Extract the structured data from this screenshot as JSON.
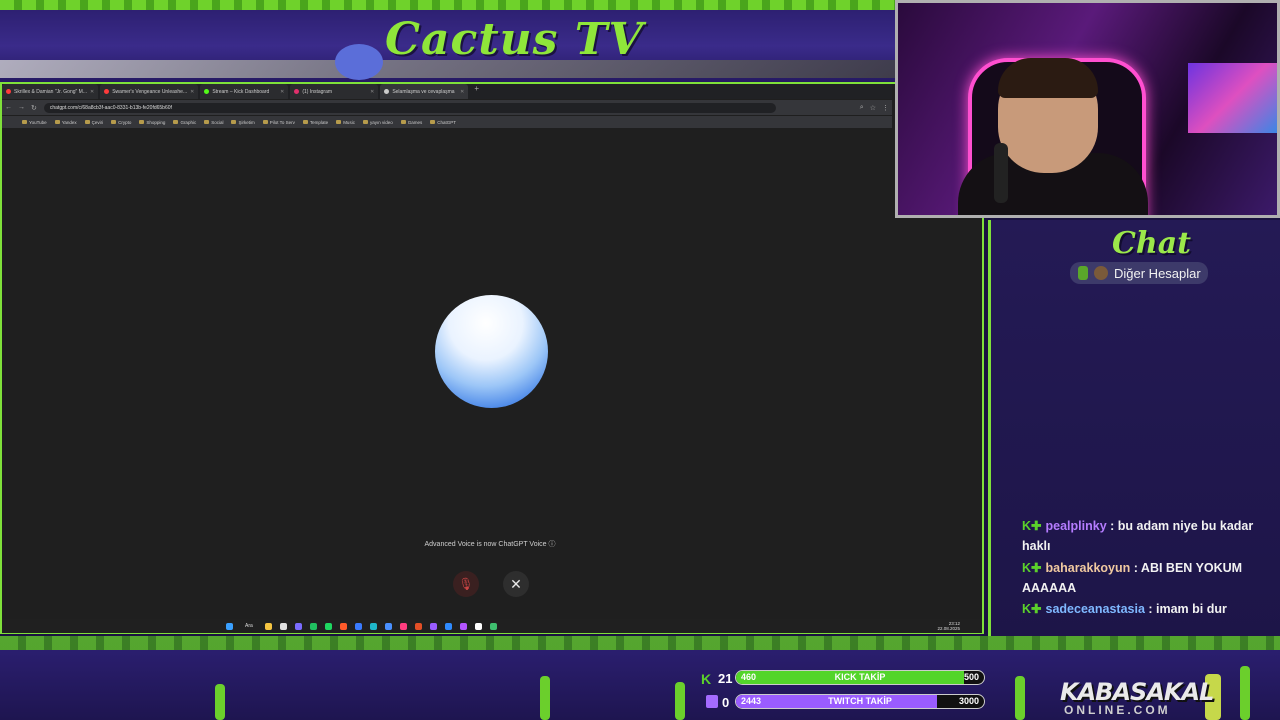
{
  "overlay": {
    "logo_text": "Cactus TV",
    "chat_title": "Chat",
    "accounts_label": "Diğer Hesaplar",
    "brand_main": "KABASAKAL",
    "brand_sub": "ONLINE.COM"
  },
  "browser": {
    "tabs": [
      {
        "label": "Skrillex & Damian \"Jr. Gong\" M...",
        "color": "#ff3b3b",
        "active": false
      },
      {
        "label": "Swamer's Vengeance Unleashe...",
        "color": "#ff3b3b",
        "active": false
      },
      {
        "label": "Stream – Kick Dashboard",
        "color": "#53fc18",
        "active": false
      },
      {
        "label": "(1) Instagram",
        "color": "#e1306c",
        "active": false
      },
      {
        "label": "Selamlaşma ve cevaplaşma",
        "color": "#cccccc",
        "active": true
      }
    ],
    "url": "chatgpt.com/c/68a8cb3f-aac0-8331-b13b-fe20fd65b60f",
    "bookmarks": [
      "YouTube",
      "Yandex",
      "Çeviri",
      "Crypto",
      "Shopping",
      "Graphic",
      "Social",
      "Şirketim",
      "Pilot To Serv",
      "Template",
      "Music",
      "yayın video",
      "Games",
      "ChatGPT"
    ]
  },
  "voice": {
    "notice": "Advanced Voice is now ChatGPT Voice ⓘ"
  },
  "taskbar": {
    "search_label": "Ara",
    "time": "23:12",
    "date": "22.08.2025"
  },
  "chat": {
    "messages": [
      {
        "user": "pealplinky",
        "user_color": "#b57cff",
        "text": " : bu adam niye bu kadar haklı"
      },
      {
        "user": "baharakkoyun",
        "user_color": "#f0c9a0",
        "text": " : ABI BEN YOKUM AAAAAA"
      },
      {
        "user": "sadeceanastasia",
        "user_color": "#7fb8ff",
        "text": " : imam bi dur"
      }
    ]
  },
  "stats": {
    "kick_count": "21",
    "twitch_count": "0",
    "kick_bar": {
      "current": "460",
      "label": "KICK TAKİP",
      "goal": "500",
      "progress": 0.92,
      "color": "#53d52a"
    },
    "twitch_bar": {
      "current": "2443",
      "label": "TWITCH TAKİP",
      "goal": "3000",
      "progress": 0.81,
      "color": "#9a5cff"
    }
  }
}
